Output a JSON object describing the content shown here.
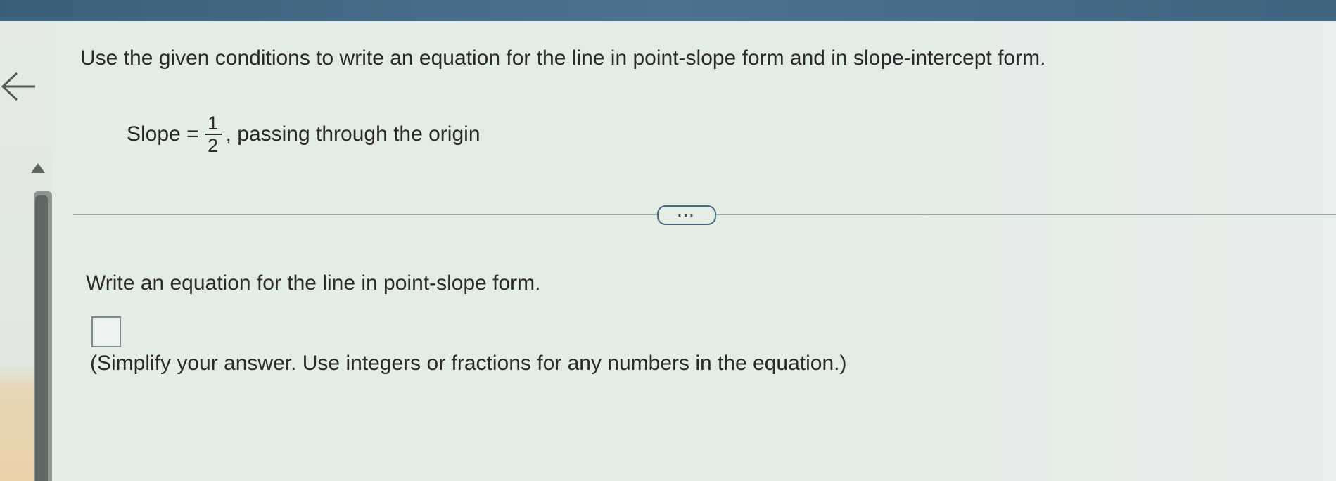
{
  "header": {
    "question": "Use the given conditions to write an equation for the line in point-slope form and in slope-intercept form."
  },
  "condition": {
    "prefix": "Slope =",
    "numerator": "1",
    "denominator": "2",
    "suffix": ", passing through the origin"
  },
  "more_button": {
    "label": "..."
  },
  "part": {
    "prompt": "Write an equation for the line in point-slope form.",
    "answer_value": "",
    "hint": "(Simplify your answer. Use integers or fractions for any numbers in the equation.)"
  },
  "icons": {
    "back": "arrow-left-icon",
    "scroll_up": "triangle-up-icon"
  },
  "colors": {
    "top_bar": "#4b7390",
    "accent": "#47697f",
    "background": "#e4ece6"
  }
}
